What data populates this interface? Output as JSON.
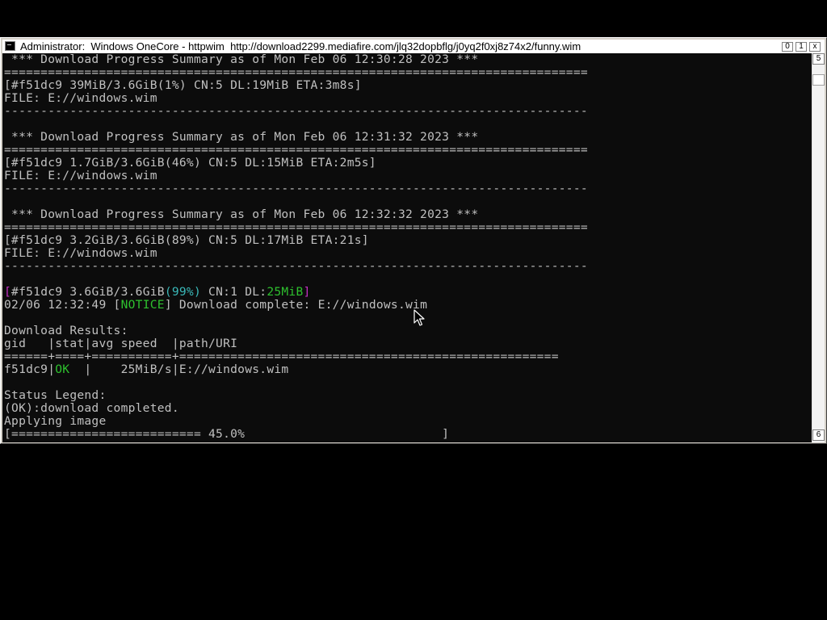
{
  "window": {
    "title": "Administrator:  Windows OneCore - httpwim  http://download2299.mediafire.com/jlq32dopbflg/j0yq2f0xj8z74x2/funny.wim",
    "buttons": {
      "minimize": "0",
      "maximize": "1",
      "close": "x"
    }
  },
  "scrollbar": {
    "up_label": "5",
    "down_label": "6"
  },
  "terminal": {
    "lines": [
      [
        {
          "t": " *** Download Progress Summary as of Mon Feb 06 12:30:28 2023 ***"
        }
      ],
      [
        {
          "t": "================================================================================"
        }
      ],
      [
        {
          "t": "[#f51dc9 39MiB/3.6GiB(1%) CN:5 DL:19MiB ETA:3m8s]"
        }
      ],
      [
        {
          "t": "FILE: E://windows.wim"
        }
      ],
      [
        {
          "t": "--------------------------------------------------------------------------------"
        }
      ],
      [
        {
          "t": ""
        }
      ],
      [
        {
          "t": " *** Download Progress Summary as of Mon Feb 06 12:31:32 2023 ***"
        }
      ],
      [
        {
          "t": "================================================================================"
        }
      ],
      [
        {
          "t": "[#f51dc9 1.7GiB/3.6GiB(46%) CN:5 DL:15MiB ETA:2m5s]"
        }
      ],
      [
        {
          "t": "FILE: E://windows.wim"
        }
      ],
      [
        {
          "t": "--------------------------------------------------------------------------------"
        }
      ],
      [
        {
          "t": ""
        }
      ],
      [
        {
          "t": " *** Download Progress Summary as of Mon Feb 06 12:32:32 2023 ***"
        }
      ],
      [
        {
          "t": "================================================================================"
        }
      ],
      [
        {
          "t": "[#f51dc9 3.2GiB/3.6GiB(89%) CN:5 DL:17MiB ETA:21s]"
        }
      ],
      [
        {
          "t": "FILE: E://windows.wim"
        }
      ],
      [
        {
          "t": "--------------------------------------------------------------------------------"
        }
      ],
      [
        {
          "t": ""
        }
      ],
      [
        {
          "t": "[",
          "c": "magenta"
        },
        {
          "t": "#f51dc9 3.6GiB/3.6GiB"
        },
        {
          "t": "(99%)",
          "c": "cyan"
        },
        {
          "t": " CN:1 DL:"
        },
        {
          "t": "25MiB",
          "c": "green"
        },
        {
          "t": "]",
          "c": "magenta"
        }
      ],
      [
        {
          "t": "02/06 12:32:49 ["
        },
        {
          "t": "NOTICE",
          "c": "green"
        },
        {
          "t": "] Download complete: E://windows.wim"
        }
      ],
      [
        {
          "t": ""
        }
      ],
      [
        {
          "t": "Download Results:"
        }
      ],
      [
        {
          "t": "gid   |stat|avg speed  |path/URI"
        }
      ],
      [
        {
          "t": "======+====+===========+===================================================="
        }
      ],
      [
        {
          "t": "f51dc9|"
        },
        {
          "t": "OK",
          "c": "green"
        },
        {
          "t": "  |    25MiB/s|E://windows.wim"
        }
      ],
      [
        {
          "t": ""
        }
      ],
      [
        {
          "t": "Status Legend:"
        }
      ],
      [
        {
          "t": "(OK):download completed."
        }
      ],
      [
        {
          "t": "Applying image"
        }
      ],
      [
        {
          "t": "[========================== 45.0%                           ]"
        }
      ]
    ]
  },
  "progress": {
    "apply_image_percent": 45.0
  },
  "colors": {
    "magenta": "#c530c5",
    "cyan": "#3ab9b9",
    "green": "#2ec02e",
    "text": "#c0c0c0",
    "background": "#0c0c0c"
  }
}
